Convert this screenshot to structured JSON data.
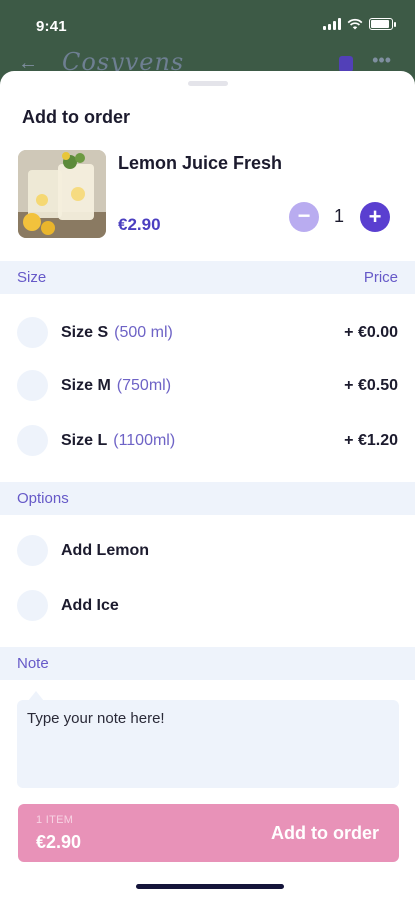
{
  "status_bar": {
    "time": "9:41",
    "battery_level": 0.9
  },
  "background_app": {
    "logo_text": "Cosyvens"
  },
  "sheet": {
    "title": "Add to order"
  },
  "product": {
    "name": "Lemon Juice Fresh",
    "price": "€2.90",
    "quantity": "1",
    "minus_symbol": "−",
    "plus_symbol": "+"
  },
  "size_section": {
    "header": "Size",
    "price_header": "Price",
    "items": [
      {
        "name": "Size S",
        "volume": "(500 ml)",
        "price": "+ €0.00"
      },
      {
        "name": "Size M",
        "volume": "(750ml)",
        "price": "+ €0.50"
      },
      {
        "name": "Size L",
        "volume": "(1100ml)",
        "price": "+ €1.20"
      }
    ]
  },
  "options_section": {
    "header": "Options",
    "items": [
      {
        "name": "Add Lemon"
      },
      {
        "name": "Add Ice"
      }
    ]
  },
  "note_section": {
    "header": "Note",
    "placeholder": "Type your note here!"
  },
  "cta": {
    "item_count": "1 ITEM",
    "total": "€2.90",
    "label": "Add to order"
  },
  "colors": {
    "accent": "#5a3fd0",
    "accent_light": "#b9acf0",
    "section_bg": "#eef3fb",
    "cta_bg": "#e892b8",
    "header_bg": "#3d5a46"
  }
}
